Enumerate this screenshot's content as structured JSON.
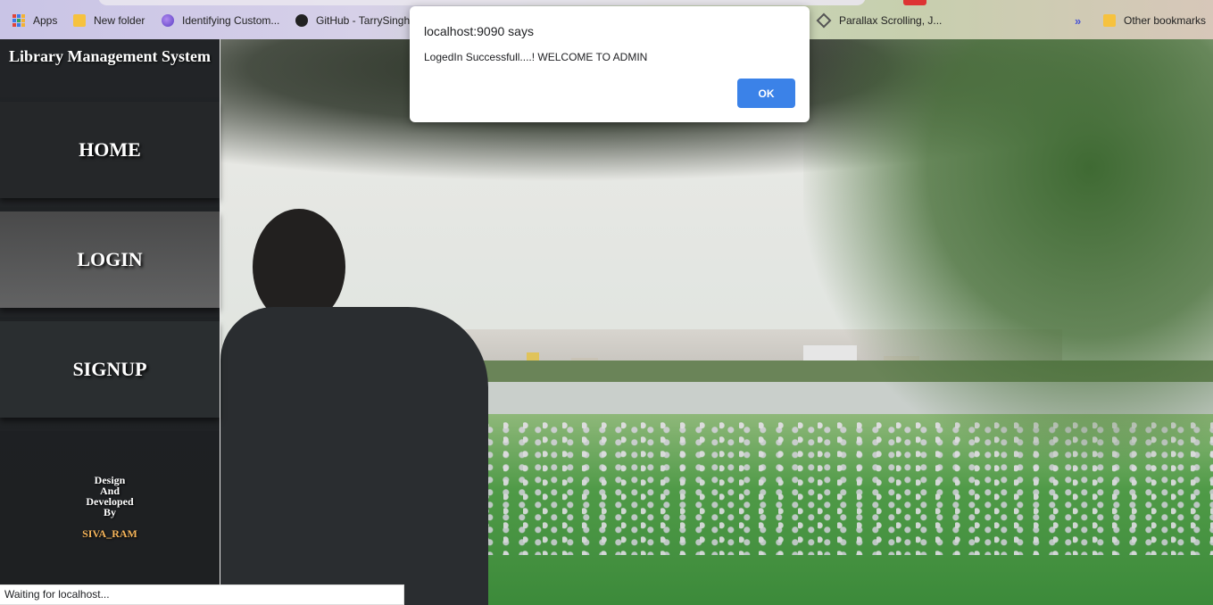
{
  "bookmarks": {
    "items": [
      {
        "label": "Apps",
        "icon": "apps-grid-icon"
      },
      {
        "label": "New folder",
        "icon": "folder-icon"
      },
      {
        "label": "Identifying Custom...",
        "icon": "globe-icon"
      },
      {
        "label": "GitHub - TarrySingh",
        "icon": "github-icon"
      },
      {
        "label": "Parallax Scrolling, J...",
        "icon": "diamond-icon"
      }
    ],
    "overflow": "»",
    "other": "Other bookmarks"
  },
  "sidebar": {
    "title": "Library Management System",
    "nav": {
      "home": "HOME",
      "login": "LOGIN",
      "signup": "SIGNUP"
    },
    "credits": {
      "line1": "Design",
      "line2": "And",
      "line3": "Developed",
      "line4": "By",
      "author": "SIVA_RAM"
    }
  },
  "dialog": {
    "title": "localhost:9090 says",
    "message": "LogedIn Successfull....! WELCOME TO ADMIN",
    "ok_label": "OK"
  },
  "status_bar": {
    "text": "Waiting for localhost..."
  },
  "colors": {
    "accent_button": "#3b82e8",
    "author_text": "#f5b45a",
    "folder": "#f6c23e"
  }
}
